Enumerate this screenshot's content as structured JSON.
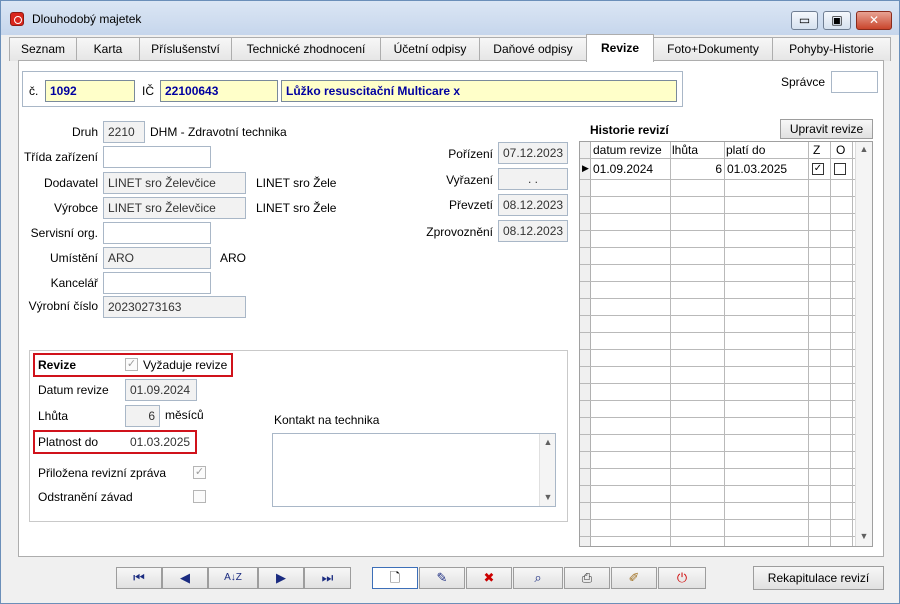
{
  "window": {
    "title": "Dlouhodobý majetek",
    "controls": {
      "minimize": "▭",
      "maximize": "▣",
      "close": "✕"
    }
  },
  "tabs": [
    {
      "label": "Seznam",
      "active": false
    },
    {
      "label": "Karta",
      "active": false
    },
    {
      "label": "Příslušenství",
      "active": false
    },
    {
      "label": "Technické zhodnocení",
      "active": false
    },
    {
      "label": "Účetní odpisy",
      "active": false
    },
    {
      "label": "Daňové odpisy",
      "active": false
    },
    {
      "label": "Revize",
      "active": true
    },
    {
      "label": "Foto+Dokumenty",
      "active": false
    },
    {
      "label": "Pohyby-Historie",
      "active": false
    }
  ],
  "header": {
    "cislo_label": "č.",
    "cislo": "1092",
    "ic_label": "IČ",
    "ic": "22100643",
    "nazev": "Lůžko resuscitační Multicare x",
    "spravce_label": "Správce",
    "spravce": ""
  },
  "detail": {
    "druh_label": "Druh",
    "druh_code": "2210",
    "druh_text": "DHM - Zdravotní technika",
    "trida_label": "Třída zařízení",
    "trida": "",
    "dodavatel_label": "Dodavatel",
    "dodavatel": "LINET sro Želevčice",
    "dodavatel_text": "LINET sro Žele",
    "vyrobce_label": "Výrobce",
    "vyrobce": "LINET sro Želevčice",
    "vyrobce_text": "LINET sro Žele",
    "servisni_label": "Servisní org.",
    "servisni": "",
    "umisteni_label": "Umístění",
    "umisteni": "ARO",
    "umisteni_text": "ARO",
    "kancelar_label": "Kancelář",
    "kancelar": "",
    "vyrobni_label": "Výrobní číslo",
    "vyrobni": "20230273163"
  },
  "dates": {
    "porizeni_label": "Pořízení",
    "porizeni": "07.12.2023",
    "vyrazeni_label": "Vyřazení",
    "vyrazeni": " .  .",
    "prevzeti_label": "Převzetí",
    "prevzeti": "08.12.2023",
    "zprovozneni_label": "Zprovoznění",
    "zprovozneni": "08.12.2023"
  },
  "revize": {
    "revize_label": "Revize",
    "vyzaduje_label": "Vyžaduje revize",
    "vyzaduje": true,
    "datum_label": "Datum revize",
    "datum": "01.09.2024",
    "lhuta_label": "Lhůta",
    "lhuta": "6",
    "lhuta_unit": "měsíců",
    "platnost_label": "Platnost do",
    "platnost": "01.03.2025",
    "prilozena_label": "Přiložena revizní zpráva",
    "prilozena": true,
    "odstraneni_label": "Odstranění závad",
    "odstraneni": false,
    "kontakt_label": "Kontakt na technika",
    "kontakt": ""
  },
  "historie": {
    "title": "Historie revizí",
    "upravit_label": "Upravit revize",
    "columns": [
      "datum revize",
      "lhůta",
      "platí do",
      "Z",
      "O"
    ],
    "rows": [
      {
        "datum": "01.09.2024",
        "lhuta": "6",
        "plati_do": "01.03.2025",
        "z": true,
        "o": false
      }
    ]
  },
  "toolbar": {
    "first": "first-record",
    "prev": "previous-record",
    "sort": "sort-az",
    "next": "next-record",
    "last": "last-record",
    "new": "new-document",
    "edit": "edit-record",
    "delete": "delete-record",
    "find": "find-record",
    "print": "print",
    "clear": "clear-eraser",
    "exit": "power-exit",
    "sort_glyph": "A↓Z",
    "rekapitulace_label": "Rekapitulace revizí"
  }
}
